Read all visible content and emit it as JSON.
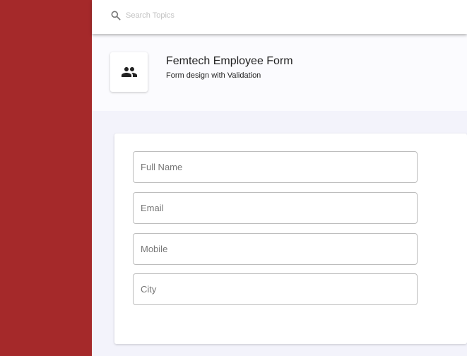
{
  "colors": {
    "sidebar": "#a5292a",
    "topbar": "#ffffff",
    "header_bg": "#fbfbfe",
    "page_bg": "#f3f3fb",
    "field_border": "#bdbdbd"
  },
  "search": {
    "icon": "search-icon",
    "placeholder": "Search Topics",
    "value": ""
  },
  "header": {
    "icon": "people-icon",
    "title": "Femtech Employee Form",
    "subtitle": "Form design with Validation"
  },
  "form": {
    "fields": [
      {
        "placeholder": "Full Name",
        "value": ""
      },
      {
        "placeholder": "Email",
        "value": ""
      },
      {
        "placeholder": "Mobile",
        "value": ""
      },
      {
        "placeholder": "City",
        "value": ""
      }
    ]
  }
}
